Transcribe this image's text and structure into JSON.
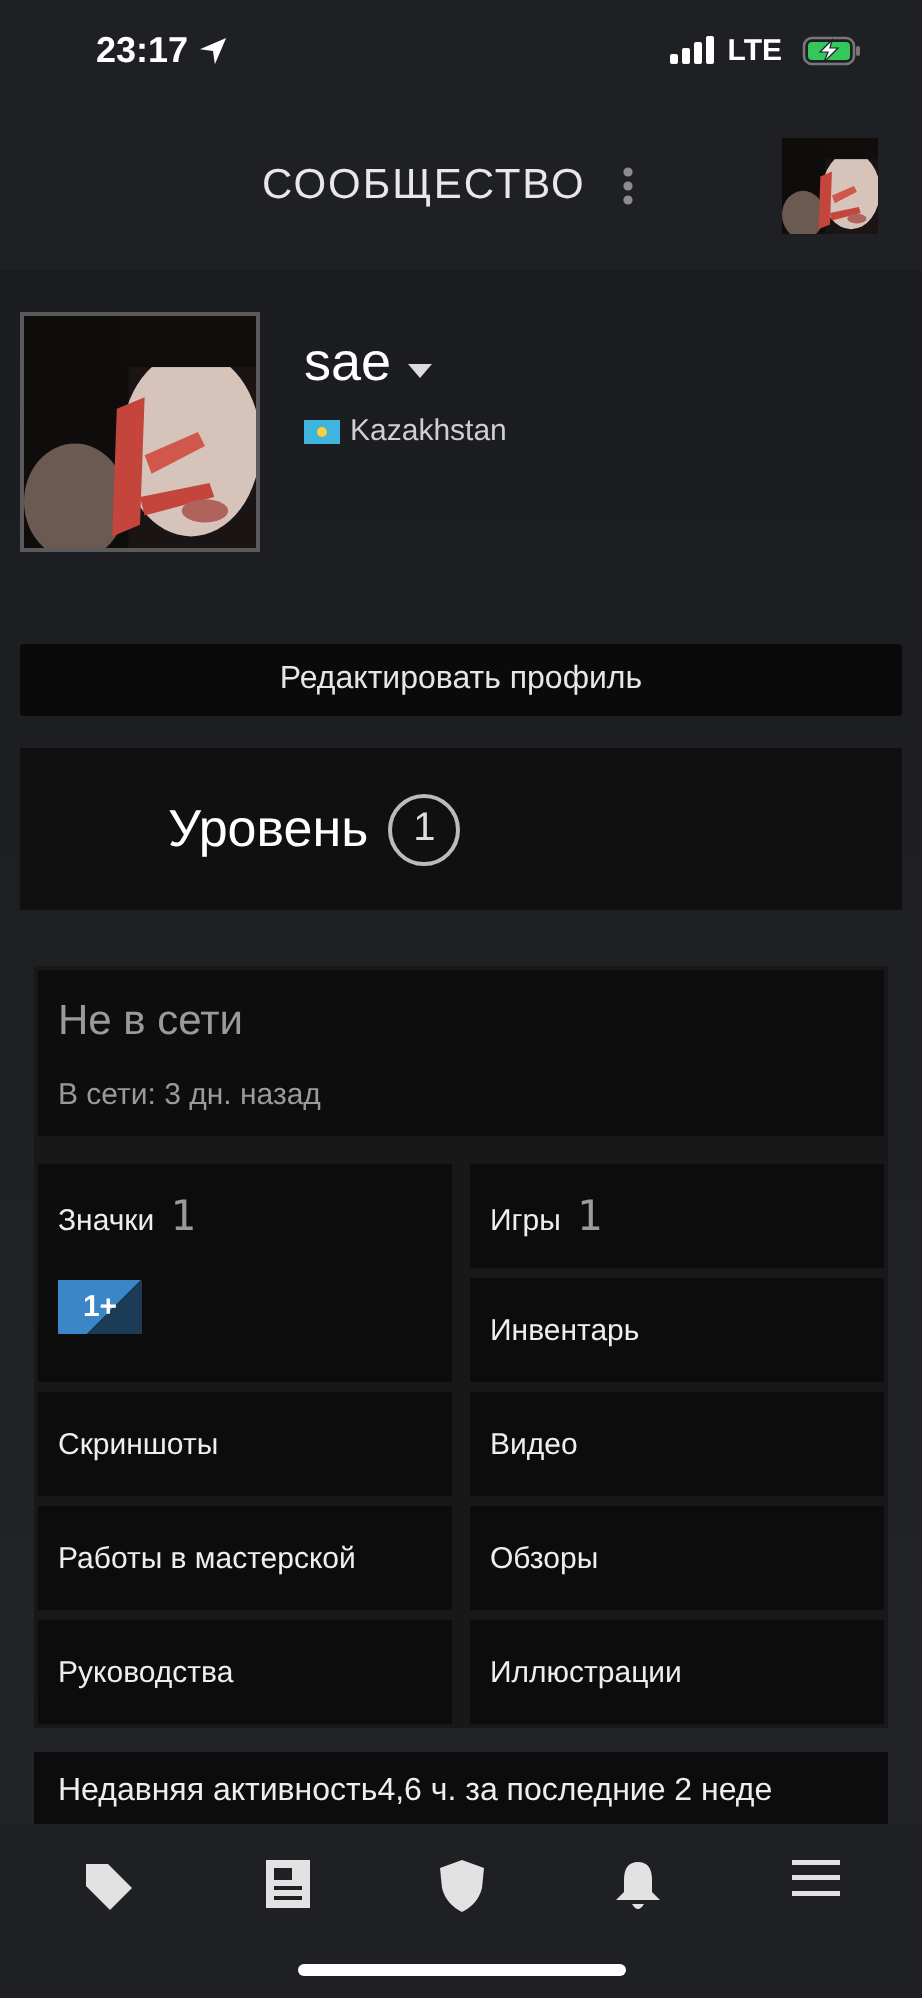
{
  "status_bar": {
    "time": "23:17",
    "network": "LTE"
  },
  "header": {
    "title": "СООБЩЕСТВО"
  },
  "profile": {
    "name": "sae",
    "country": "Kazakhstan"
  },
  "edit_button": "Редактировать профиль",
  "level": {
    "label": "Уровень",
    "value": "1"
  },
  "status": {
    "title": "Не в сети",
    "last_online": "В сети: 3 дн. назад"
  },
  "left_column": [
    {
      "label": "Значки",
      "count": "1",
      "badge": "1+"
    },
    {
      "label": "Скриншоты"
    },
    {
      "label": "Работы в мастерской"
    },
    {
      "label": "Руководства"
    }
  ],
  "right_column": [
    {
      "label": "Игры",
      "count": "1"
    },
    {
      "label": "Инвентарь"
    },
    {
      "label": "Видео"
    },
    {
      "label": "Обзоры"
    },
    {
      "label": "Иллюстрации"
    }
  ],
  "activity": {
    "text": "Недавняя активность4,6 ч. за последние 2 неде"
  }
}
